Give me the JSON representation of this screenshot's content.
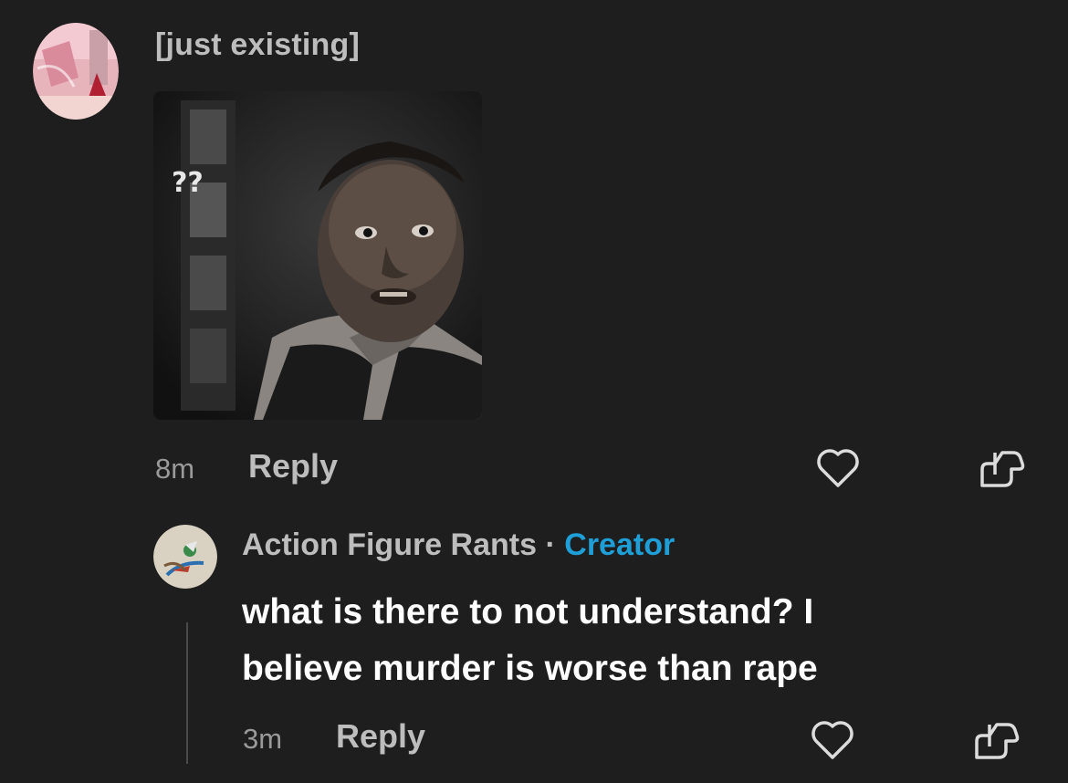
{
  "comment": {
    "username": "[just existing]",
    "gif_overlay_text": "??",
    "time": "8m",
    "reply_label": "Reply"
  },
  "reply": {
    "username": "Action Figure Rants",
    "separator": "·",
    "badge": "Creator",
    "line1": "what is there to not understand? I",
    "line2": "believe murder is worse than rape",
    "time": "3m",
    "reply_label": "Reply"
  },
  "colors": {
    "background": "#1e1e1e",
    "creator_badge": "#1e9fd8",
    "muted_text": "#bdbdbd"
  }
}
